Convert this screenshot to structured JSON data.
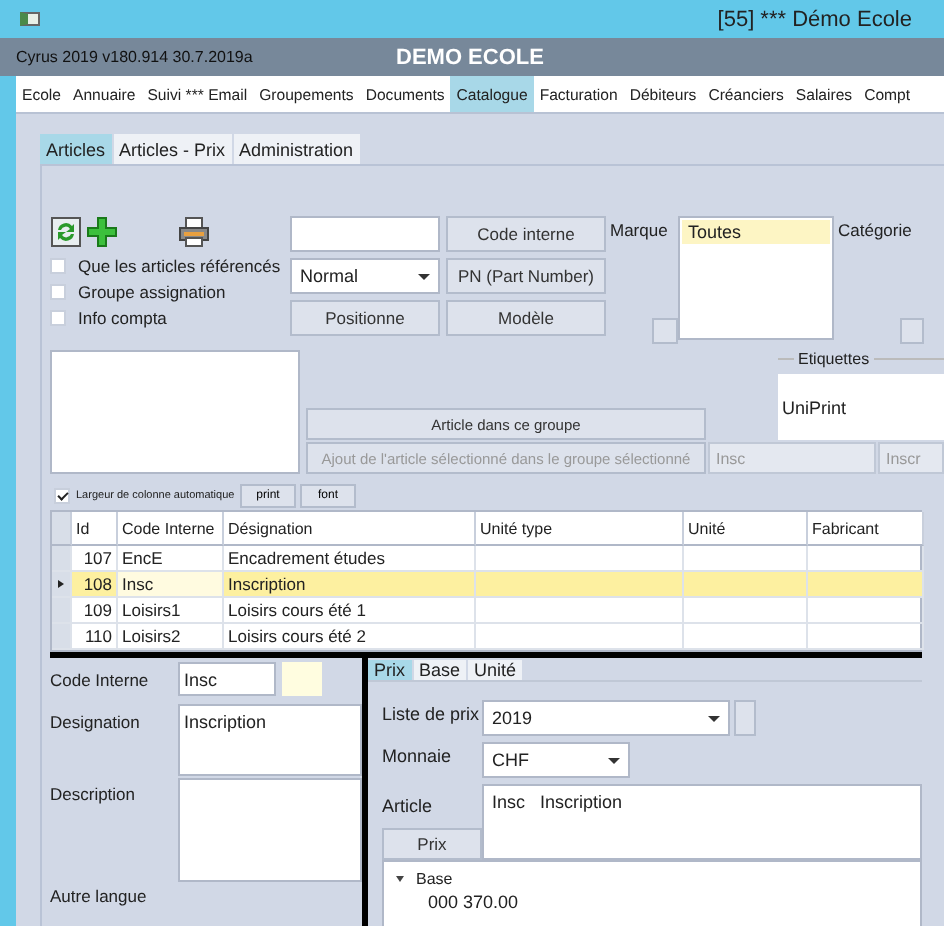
{
  "window": {
    "title": "[55] *** Démo Ecole"
  },
  "header": {
    "version": "Cyrus 2019 v180.914 30.7.2019a",
    "title": "DEMO ECOLE"
  },
  "menu": [
    {
      "label": "Ecole",
      "selected": false
    },
    {
      "label": "Annuaire",
      "selected": false
    },
    {
      "label": "Suivi *** Email",
      "selected": false
    },
    {
      "label": "Groupements",
      "selected": false
    },
    {
      "label": "Documents",
      "selected": false
    },
    {
      "label": "Catalogue",
      "selected": true
    },
    {
      "label": "Facturation",
      "selected": false
    },
    {
      "label": "Débiteurs",
      "selected": false
    },
    {
      "label": "Créanciers",
      "selected": false
    },
    {
      "label": "Salaires",
      "selected": false
    },
    {
      "label": "Compt",
      "selected": false
    }
  ],
  "subtabs": [
    {
      "label": "Articles",
      "selected": true
    },
    {
      "label": "Articles - Prix",
      "selected": false
    },
    {
      "label": "Administration",
      "selected": false
    }
  ],
  "filters": {
    "checkboxes": [
      {
        "label": "Que les articles référencés",
        "checked": false
      },
      {
        "label": "Groupe assignation",
        "checked": false
      },
      {
        "label": "Info compta",
        "checked": false
      }
    ],
    "mode": {
      "value": "Normal"
    },
    "code_button": "Code interne",
    "pn_button": "PN (Part Number)",
    "position_button": "Positionne",
    "model_button": "Modèle"
  },
  "brand": {
    "label": "Marque",
    "items": [
      {
        "label": "Toutes",
        "selected": true
      }
    ]
  },
  "category": {
    "label": "Catégorie"
  },
  "group_buttons": [
    {
      "label": "Article dans ce groupe",
      "disabled": false
    },
    {
      "label": "Ajout de l'article sélectionné dans le groupe sélectionné",
      "disabled": true
    }
  ],
  "group_fields": [
    "Insc",
    "Inscr"
  ],
  "labels": {
    "title": "Etiquettes",
    "items": [
      "UniPrint"
    ]
  },
  "grid_options": {
    "auto_width": {
      "label": "Largeur de colonne automatique",
      "checked": true
    },
    "buttons": [
      "print",
      "font"
    ]
  },
  "table": {
    "columns": [
      "Id",
      "Code Interne",
      "Désignation",
      "Unité type",
      "Unité",
      "Fabricant"
    ],
    "rows": [
      {
        "cells": [
          "107",
          "EncE",
          "Encadrement études"
        ],
        "selected": false
      },
      {
        "cells": [
          "108",
          "Insc",
          "Inscription"
        ],
        "selected": true
      },
      {
        "cells": [
          "109",
          "Loisirs1",
          "Loisirs cours été 1"
        ],
        "selected": false
      },
      {
        "cells": [
          "110",
          "Loisirs2",
          "Loisirs cours été 2"
        ],
        "selected": false
      }
    ]
  },
  "detail": {
    "fields": [
      {
        "label": "Code Interne",
        "value": "Insc",
        "kind": "input"
      },
      {
        "label": "Designation",
        "value": "Inscription",
        "kind": "textarea"
      },
      {
        "label": "Description",
        "kind": "bigtext"
      },
      {
        "label": "Autre langue",
        "kind": "label"
      }
    ]
  },
  "price_panel": {
    "tabs": [
      {
        "label": "Prix",
        "selected": true
      },
      {
        "label": "Base",
        "selected": false
      },
      {
        "label": "Unité",
        "selected": false
      }
    ],
    "price_list": {
      "label": "Liste de prix",
      "value": "2019"
    },
    "currency": {
      "label": "Monnaie",
      "value": "CHF"
    },
    "article": {
      "label": "Article",
      "value": "Insc   Inscription"
    },
    "prix_button": "Prix",
    "tree": [
      {
        "label": "Base",
        "expanded": true,
        "children": [
          {
            "label": "000 370.00"
          }
        ]
      }
    ]
  }
}
